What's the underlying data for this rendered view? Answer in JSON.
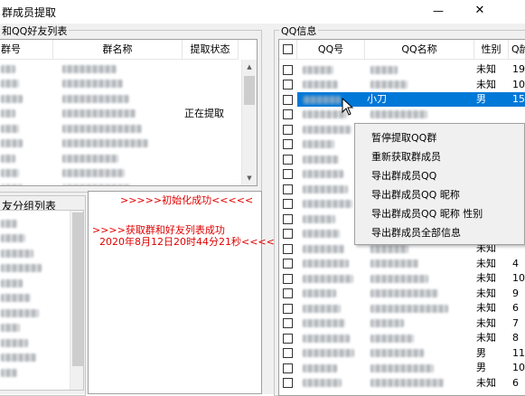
{
  "window": {
    "title": "群成员提取",
    "min_glyph": "—",
    "close_glyph": "✕"
  },
  "left_group": {
    "title": "和QQ好友列表",
    "columns": [
      "群号",
      "群名称",
      "提取状态"
    ],
    "rows": [
      {
        "status": ""
      },
      {
        "status": ""
      },
      {
        "status": ""
      },
      {
        "status": "正在提取"
      },
      {
        "status": ""
      },
      {
        "status": ""
      },
      {
        "status": ""
      },
      {
        "status": ""
      },
      {
        "status": ""
      }
    ]
  },
  "friend_group": {
    "title": "友分组列表",
    "rows": 11
  },
  "log": {
    "lines": [
      ">>>>>初始化成功<<<<<",
      ">>>>获取群和好友列表成功",
      "2020年8月12日20时44分21秒<<<<"
    ]
  },
  "right_group": {
    "title": "QQ信息",
    "columns": [
      "QQ号",
      "QQ名称",
      "性别",
      "Q龄"
    ],
    "rows": [
      {
        "name": "",
        "gender": "未知",
        "age": "19",
        "selected": false
      },
      {
        "name": "",
        "gender": "未知",
        "age": "10",
        "selected": false
      },
      {
        "name": "小刀",
        "gender": "男",
        "age": "15",
        "selected": true
      },
      {
        "name": "",
        "gender": "",
        "age": "",
        "selected": false
      },
      {
        "name": "",
        "gender": "",
        "age": "",
        "selected": false
      },
      {
        "name": "",
        "gender": "",
        "age": "",
        "selected": false
      },
      {
        "name": "",
        "gender": "",
        "age": "",
        "selected": false
      },
      {
        "name": "",
        "gender": "",
        "age": "",
        "selected": false
      },
      {
        "name": "",
        "gender": "",
        "age": "",
        "selected": false
      },
      {
        "name": "",
        "gender": "",
        "age": "",
        "selected": false
      },
      {
        "name": "",
        "gender": "",
        "age": "",
        "selected": false
      },
      {
        "name": "",
        "gender": "",
        "age": "",
        "selected": false
      },
      {
        "name": "",
        "gender": "未知",
        "age": "",
        "selected": false
      },
      {
        "name": "",
        "gender": "未知",
        "age": "4",
        "selected": false
      },
      {
        "name": "",
        "gender": "未知",
        "age": "10",
        "selected": false
      },
      {
        "name": "",
        "gender": "未知",
        "age": "9",
        "selected": false
      },
      {
        "name": "",
        "gender": "未知",
        "age": "6",
        "selected": false
      },
      {
        "name": "",
        "gender": "未知",
        "age": "7",
        "selected": false
      },
      {
        "name": "",
        "gender": "未知",
        "age": "8",
        "selected": false
      },
      {
        "name": "",
        "gender": "男",
        "age": "11",
        "selected": false
      },
      {
        "name": "",
        "gender": "男",
        "age": "10",
        "selected": false
      },
      {
        "name": "",
        "gender": "未知",
        "age": "6",
        "selected": false
      }
    ]
  },
  "context_menu": {
    "items": [
      "暂停提取QQ群",
      "重新获取群成员",
      "导出群成员QQ",
      "导出群成员QQ 昵称",
      "导出群成员QQ 昵称 性别",
      "导出群成员全部信息"
    ]
  },
  "icons": {
    "scroll_up": "▲",
    "scroll_down": "▼"
  }
}
